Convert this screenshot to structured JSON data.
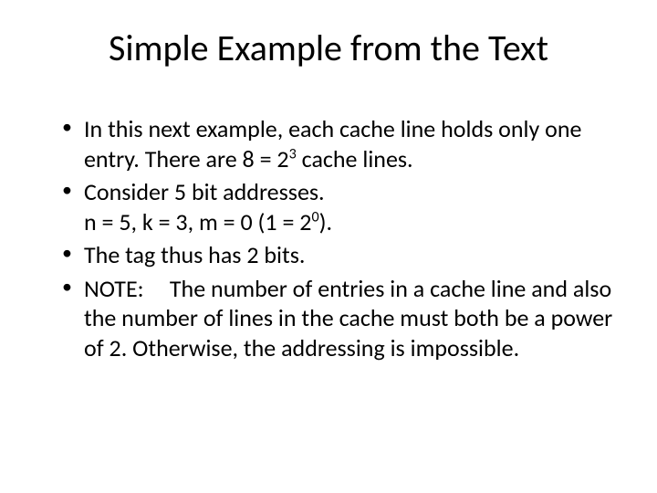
{
  "title": "Simple Example from the Text",
  "bullets": {
    "b0a": "In this next example, each cache line holds only one entry.  There are 8 = 2",
    "b0sup": "3",
    "b0b": " cache lines.",
    "b1a": "Consider 5 bit addresses.",
    "b1b": "n = 5, k = 3, m = 0 (1 = 2",
    "b1sup": "0",
    "b1c": ").",
    "b2": "The tag thus has 2 bits.",
    "b3label": "NOTE:",
    "b3": "The number of entries in a cache line and also the number of lines in the cache must both be a power of 2.  Otherwise, the addressing is impossible."
  }
}
